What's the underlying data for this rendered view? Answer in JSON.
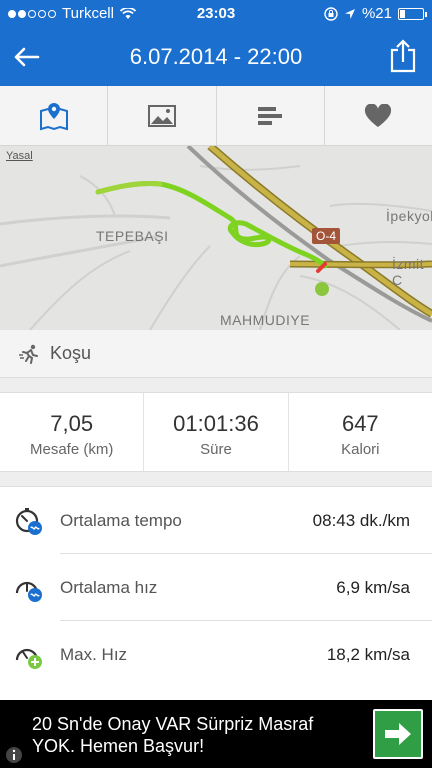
{
  "status_bar": {
    "carrier": "Turkcell",
    "time": "23:03",
    "battery": "%21"
  },
  "header": {
    "title": "6.07.2014 - 22:00"
  },
  "tabs": [
    {
      "icon": "map-icon"
    },
    {
      "icon": "image-icon"
    },
    {
      "icon": "splits-icon"
    },
    {
      "icon": "heart-icon"
    }
  ],
  "map": {
    "legal_link": "Yasal",
    "labels": {
      "tepebasi": "TEPEBAŞI",
      "mahmudiye": "MAHMUDIYE",
      "ipekyol": "İpekyol",
      "izmit": "İzmit C"
    },
    "road_badge": "O-4"
  },
  "activity": {
    "type": "Koşu"
  },
  "summary": {
    "distance": {
      "value": "7,05",
      "label": "Mesafe (km)"
    },
    "duration": {
      "value": "01:01:36",
      "label": "Süre"
    },
    "calories": {
      "value": "647",
      "label": "Kalori"
    }
  },
  "details": [
    {
      "label": "Ortalama tempo",
      "value": "08:43 dk./km",
      "icon": "pace-icon"
    },
    {
      "label": "Ortalama hız",
      "value": "6,9 km/sa",
      "icon": "speed-icon"
    },
    {
      "label": "Max. Hız",
      "value": "18,2 km/sa",
      "icon": "max-speed-icon"
    }
  ],
  "ad": {
    "text": "20 Sn'de Onay VAR Sürpriz Masraf YOK. Hemen Başvur!"
  },
  "colors": {
    "header_blue": "#1b6fcf",
    "route_green": "#7ed321",
    "badge_green": "#2f9e44"
  }
}
